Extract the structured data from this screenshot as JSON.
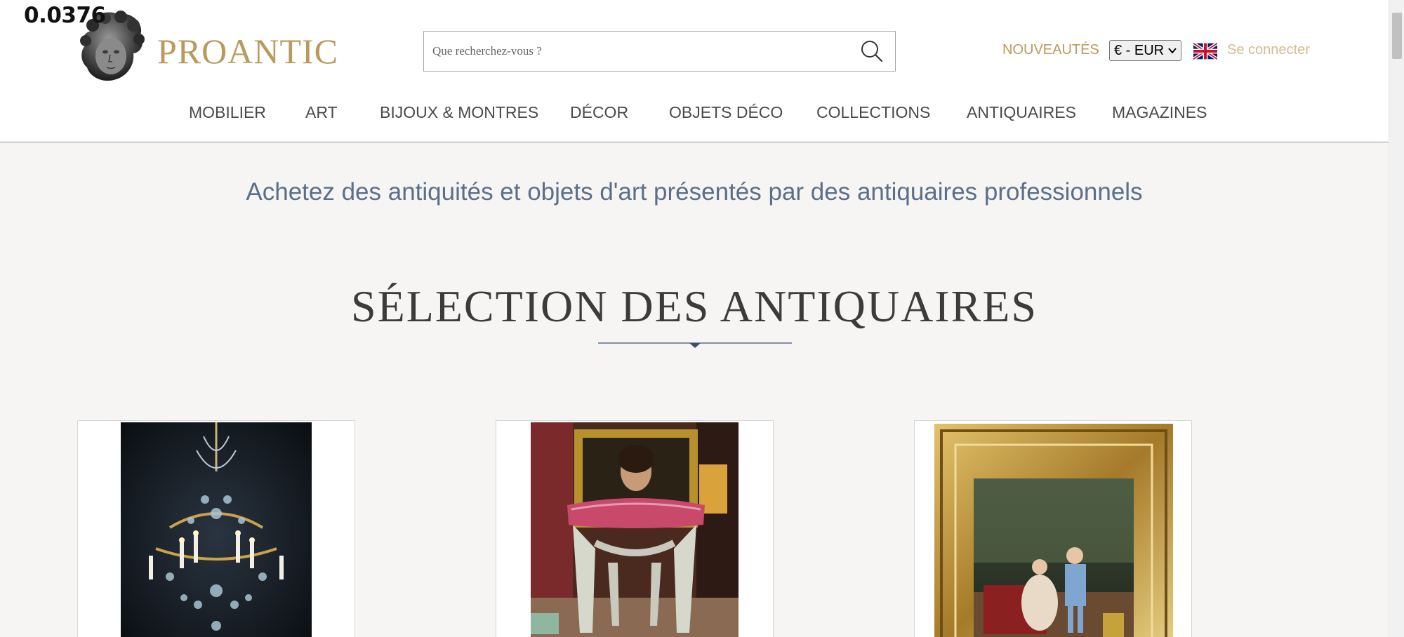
{
  "overlay": {
    "value": "0.0376"
  },
  "brand": {
    "name": "PROANTIC",
    "color": "#b99a5b",
    "logo_icon": "cherub-head-icon"
  },
  "search": {
    "placeholder": "Que recherchez-vous ?",
    "value": ""
  },
  "header_links": {
    "new_label": "NOUVEAUTÉS",
    "currency": "€ - EUR",
    "language_icon": "uk-flag-icon",
    "login_label": "Se connecter"
  },
  "nav": {
    "items": [
      {
        "label": "MOBILIER"
      },
      {
        "label": "ART"
      },
      {
        "label": "BIJOUX & MONTRES"
      },
      {
        "label": "DÉCOR"
      },
      {
        "label": "OBJETS DÉCO"
      },
      {
        "label": "COLLECTIONS"
      },
      {
        "label": "ANTIQUAIRES"
      },
      {
        "label": "MAGAZINES"
      }
    ]
  },
  "main": {
    "tagline": "Achetez des antiquités et objets d'art présentés par des antiquaires professionnels",
    "section_title": "SÉLECTION DES ANTIQUAIRES",
    "cards": [
      {
        "image": "crystal-chandelier"
      },
      {
        "image": "portrait-and-stool"
      },
      {
        "image": "framed-gallant-scene-painting"
      }
    ]
  },
  "colors": {
    "accent_gold": "#b99a5b",
    "tagline_blue": "#5b6f88",
    "page_bg": "#f6f5f3"
  }
}
